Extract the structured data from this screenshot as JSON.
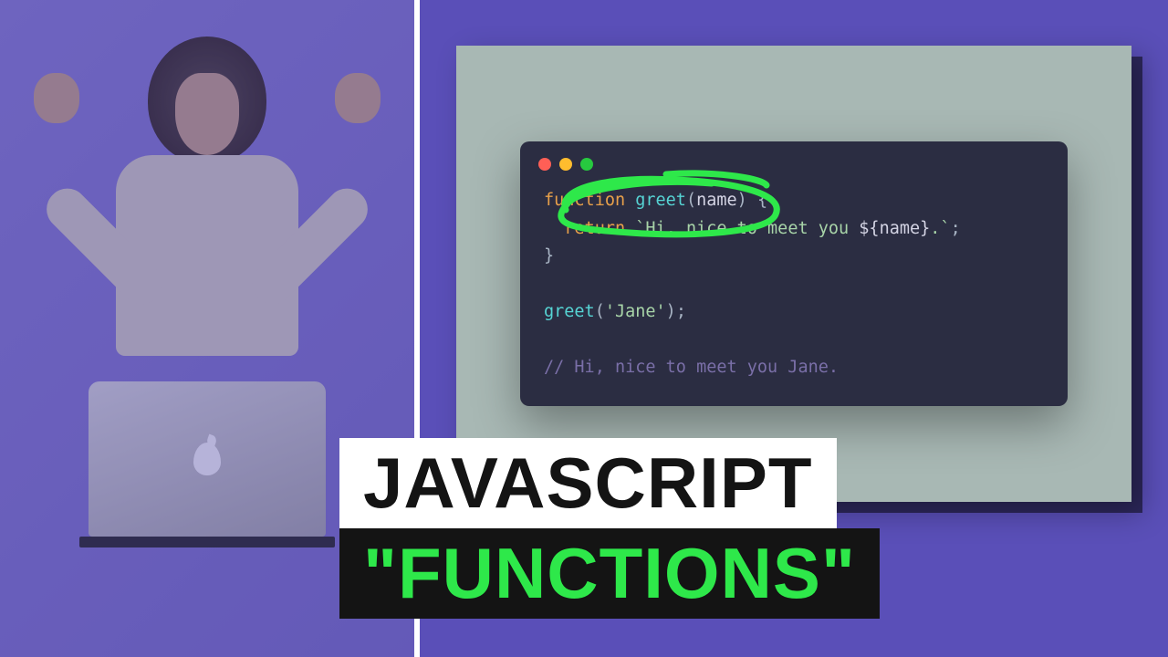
{
  "title": {
    "line1": "JAVASCRIPT",
    "line2": "\"FUNCTIONS\""
  },
  "code": {
    "keyword_function": "function",
    "fn_name": "greet",
    "param": "name",
    "keyword_return": "return",
    "string_open": "`Hi, nice to meet you ",
    "interp_open": "${",
    "interp_var": "name",
    "interp_close": "}",
    "string_close": ".`",
    "call_fn": "greet",
    "call_arg": "'Jane'",
    "comment": "// Hi, nice to meet you Jane."
  },
  "colors": {
    "bg_purple": "#5a4fb8",
    "slide_bg": "#a8b8b4",
    "code_bg": "#2b2d42",
    "annot_green": "#2ee84a"
  }
}
